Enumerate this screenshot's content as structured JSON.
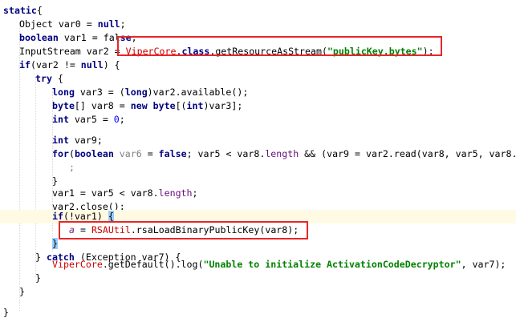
{
  "lines": [
    {
      "id": "l1",
      "tokens": [
        [
          "kw",
          "static"
        ],
        [
          "",
          "{"
        ]
      ]
    },
    {
      "id": "l2",
      "tokens": [
        [
          "",
          "Object var0 = "
        ],
        [
          "kw",
          "null"
        ],
        [
          "",
          ";"
        ]
      ]
    },
    {
      "id": "l3",
      "tokens": [
        [
          "kw",
          "boolean"
        ],
        [
          "",
          " var1 = fal"
        ],
        [
          "kw",
          "se"
        ],
        [
          "",
          ";"
        ]
      ]
    },
    {
      "id": "l4",
      "tokens": [
        [
          "",
          "InputStream var2 = "
        ],
        [
          "err",
          "ViperCore"
        ],
        [
          "",
          "."
        ],
        [
          "kw",
          "class"
        ],
        [
          "",
          ".getResourceAsStream("
        ],
        [
          "str",
          "\"publicKey.bytes\""
        ],
        [
          "",
          ");"
        ]
      ]
    },
    {
      "id": "l5",
      "tokens": [
        [
          "kw",
          "if"
        ],
        [
          "",
          "(var2 != "
        ],
        [
          "kw",
          "null"
        ],
        [
          "",
          ") {"
        ]
      ]
    },
    {
      "id": "l6",
      "tokens": [
        [
          "kw",
          "try"
        ],
        [
          "",
          " {"
        ]
      ]
    },
    {
      "id": "l7",
      "tokens": [
        [
          "kw",
          "long"
        ],
        [
          "",
          " var3 = ("
        ],
        [
          "kw",
          "long"
        ],
        [
          "",
          ")var2.available();"
        ]
      ]
    },
    {
      "id": "l8",
      "tokens": [
        [
          "kw",
          "byte"
        ],
        [
          "",
          "[] var8 = "
        ],
        [
          "kw",
          "new byte"
        ],
        [
          "",
          "[("
        ],
        [
          "kw",
          "int"
        ],
        [
          "",
          ")var3];"
        ]
      ]
    },
    {
      "id": "l9",
      "tokens": [
        [
          "kw",
          "int"
        ],
        [
          "",
          " var5 = "
        ],
        [
          "num",
          "0"
        ],
        [
          "",
          ";"
        ]
      ]
    },
    {
      "id": "l10",
      "tokens": []
    },
    {
      "id": "l11",
      "tokens": [
        [
          "kw",
          "int"
        ],
        [
          "",
          " var9;"
        ]
      ]
    },
    {
      "id": "l12",
      "tokens": [
        [
          "kw",
          "for"
        ],
        [
          "",
          "("
        ],
        [
          "kw",
          "boolean"
        ],
        [
          "",
          " "
        ],
        [
          "gray",
          "var6"
        ],
        [
          "",
          " = "
        ],
        [
          "kw",
          "false"
        ],
        [
          "",
          "; var5 < var8."
        ],
        [
          "field",
          "length"
        ],
        [
          "",
          " && (var9 = var2.read(var8, var5, var8."
        ]
      ]
    },
    {
      "id": "l13",
      "tokens": [
        [
          "gray",
          ";"
        ]
      ]
    },
    {
      "id": "l14",
      "tokens": [
        [
          "",
          "}"
        ]
      ]
    },
    {
      "id": "l15",
      "tokens": []
    },
    {
      "id": "l16",
      "tokens": [
        [
          "",
          "var1 = var5 < var8."
        ],
        [
          "field",
          "length"
        ],
        [
          "",
          ";"
        ]
      ]
    },
    {
      "id": "l17",
      "tokens": [
        [
          "",
          "var2.close();"
        ]
      ]
    },
    {
      "id": "l18",
      "tokens": [
        [
          "kw",
          "if"
        ],
        [
          "",
          "(!var1) "
        ],
        [
          "brace",
          "{"
        ]
      ]
    },
    {
      "id": "l19",
      "tokens": [
        [
          "purple",
          "a"
        ],
        [
          "",
          " = "
        ],
        [
          "err",
          "RSAUtil"
        ],
        [
          "",
          ".rsaLoadBinaryPublicKey(var8);"
        ]
      ]
    },
    {
      "id": "l20",
      "tokens": [
        [
          "brace",
          "}"
        ]
      ]
    },
    {
      "id": "l21",
      "tokens": [
        [
          "",
          "} "
        ],
        [
          "kw",
          "catch"
        ],
        [
          "",
          " (Exception var7) {"
        ]
      ]
    },
    {
      "id": "l22",
      "tokens": [
        [
          "err",
          "ViperCore"
        ],
        [
          "",
          ".getDefault().log("
        ],
        [
          "str",
          "\"Unable to initialize ActivationCodeDecryptor\""
        ],
        [
          "",
          ", var7);"
        ]
      ]
    },
    {
      "id": "l23",
      "tokens": [
        [
          "",
          "}"
        ]
      ]
    },
    {
      "id": "l24",
      "tokens": [
        [
          "",
          "}"
        ]
      ]
    },
    {
      "id": "l25",
      "tokens": []
    },
    {
      "id": "l26",
      "tokens": [
        [
          "",
          "}"
        ]
      ]
    }
  ],
  "colors": {
    "keyword": "#000080",
    "string": "#008000",
    "error": "#cc0000",
    "highlight_box": "#e8262b",
    "current_line": "#fffae3"
  }
}
